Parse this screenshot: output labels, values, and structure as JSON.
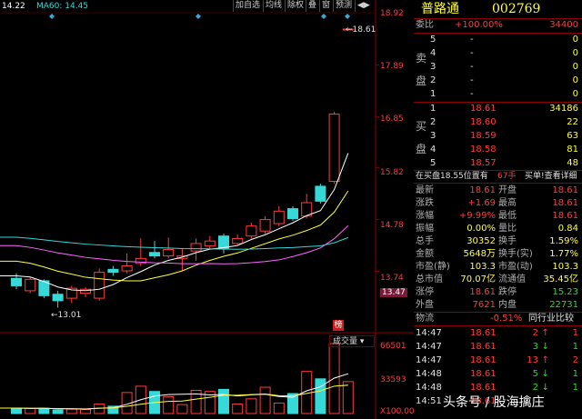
{
  "header": {
    "ma_labels": [
      {
        "text": "14.22",
        "color": "#ffffff"
      },
      {
        "text": "MA60: 14.45",
        "color": "#36d8d8"
      }
    ],
    "toolbar": [
      "加自选",
      "均线",
      "除权",
      "叠",
      "窗",
      "预测",
      "◀▶"
    ]
  },
  "price_axis": [
    "18.92",
    "17.89",
    "16.85",
    "15.82",
    "14.78",
    "13.74",
    "13.47"
  ],
  "price_callouts": {
    "high": "18.61",
    "low": "13.01"
  },
  "volume_axis": [
    "66501",
    "33593",
    "X100.00"
  ],
  "volume_tag": "成交量",
  "bang_badge": "榜",
  "stock": {
    "name": "普路通",
    "code": "002769"
  },
  "ratio": {
    "label": "委比",
    "percent": "+100.00%",
    "value": "34400"
  },
  "sell_side": {
    "label": [
      "卖",
      "盘"
    ],
    "rows": [
      {
        "level": "5",
        "price": "-",
        "volume": "0"
      },
      {
        "level": "4",
        "price": "-",
        "volume": "0"
      },
      {
        "level": "3",
        "price": "-",
        "volume": "0"
      },
      {
        "level": "2",
        "price": "-",
        "volume": "0"
      },
      {
        "level": "1",
        "price": "-",
        "volume": "0"
      }
    ]
  },
  "buy_side": {
    "label": [
      "买",
      "盘"
    ],
    "rows": [
      {
        "level": "1",
        "price": "18.61",
        "volume": "34186"
      },
      {
        "level": "2",
        "price": "18.60",
        "volume": "22"
      },
      {
        "level": "3",
        "price": "18.59",
        "volume": "63"
      },
      {
        "level": "4",
        "price": "18.58",
        "volume": "81"
      },
      {
        "level": "5",
        "price": "18.57",
        "volume": "48"
      }
    ]
  },
  "notice": {
    "left": "在买盘18.55位置有",
    "mid": "67手",
    "right": "买单!查看详细"
  },
  "stats": [
    {
      "l1": "最新",
      "v1": "18.61",
      "l2": "开盘",
      "v2": "18.61",
      "c1": "red",
      "c2": "red"
    },
    {
      "l1": "涨跌",
      "v1": "+1.69",
      "l2": "最高",
      "v2": "18.61",
      "c1": "red",
      "c2": "red"
    },
    {
      "l1": "涨幅",
      "v1": "+9.99%",
      "l2": "最低",
      "v2": "18.61",
      "c1": "red",
      "c2": "red"
    },
    {
      "l1": "振幅",
      "v1": "0.00%",
      "l2": "量比",
      "v2": "0.84",
      "c1": "yellow",
      "c2": "yellow"
    },
    {
      "l1": "总手",
      "v1": "30352",
      "l2": "换手",
      "v2": "1.59%",
      "c1": "yellow",
      "c2": "yellow"
    },
    {
      "l1": "金额",
      "v1": "5648万",
      "l2": "换手(实)",
      "v2": "1.77%",
      "c1": "yellow",
      "c2": "yellow"
    },
    {
      "l1": "市盈(静)",
      "v1": "103.3",
      "l2": "市盈(动)",
      "v2": "103.3",
      "c1": "yellow",
      "c2": "yellow"
    },
    {
      "l1": "总市值",
      "v1": "70.07亿",
      "l2": "流通值",
      "v2": "35.45亿",
      "c1": "yellow",
      "c2": "yellow"
    },
    {
      "l1": "涨停",
      "v1": "18.61",
      "l2": "跌停",
      "v2": "15.23",
      "c1": "red",
      "c2": "green"
    },
    {
      "l1": "外盘",
      "v1": "7621",
      "l2": "内盘",
      "v2": "22731",
      "c1": "red",
      "c2": "green"
    }
  ],
  "tabs": {
    "left": "物流",
    "mid": "-0.51%",
    "right": "同行业比较"
  },
  "ticks": [
    {
      "time": "14:47",
      "price": "18.61",
      "volume": "2",
      "dir": "up",
      "extra": "1"
    },
    {
      "time": "14:47",
      "price": "18.61",
      "volume": "3",
      "dir": "down",
      "extra": "1"
    },
    {
      "time": "14:47",
      "price": "18.61",
      "volume": "13",
      "dir": "up",
      "extra": "2"
    },
    {
      "time": "14:48",
      "price": "18.61",
      "volume": "5",
      "dir": "down",
      "extra": "1"
    },
    {
      "time": "14:48",
      "price": "18.61",
      "volume": "2",
      "dir": "down",
      "extra": "1"
    },
    {
      "time": "14:51",
      "price": "18.61",
      "volume": "",
      "dir": "",
      "extra": ""
    }
  ],
  "watermark": "头条号 / 股海擒庄",
  "colors": {
    "up": "#ff3c3c",
    "down": "#36d8d8",
    "grid": "#8b0000",
    "ma5": "#ffffff",
    "ma10": "#ffff3c",
    "ma20": "#ff66ff",
    "ma60": "#36d8d8"
  },
  "chart_data": {
    "type": "candlestick",
    "ylim": [
      12.8,
      18.92
    ],
    "candles": [
      {
        "o": 13.6,
        "c": 13.45,
        "h": 13.7,
        "l": 13.38
      },
      {
        "o": 13.35,
        "c": 13.58,
        "h": 13.62,
        "l": 13.3
      },
      {
        "o": 13.55,
        "c": 13.25,
        "h": 13.58,
        "l": 13.2
      },
      {
        "o": 13.28,
        "c": 13.15,
        "h": 13.35,
        "l": 13.01
      },
      {
        "o": 13.2,
        "c": 13.4,
        "h": 13.45,
        "l": 13.1
      },
      {
        "o": 13.3,
        "c": 13.38,
        "h": 13.42,
        "l": 13.22
      },
      {
        "o": 13.2,
        "c": 13.72,
        "h": 13.8,
        "l": 13.15
      },
      {
        "o": 13.78,
        "c": 13.72,
        "h": 13.85,
        "l": 13.65
      },
      {
        "o": 13.75,
        "c": 13.85,
        "h": 14.1,
        "l": 13.7
      },
      {
        "o": 13.9,
        "c": 14.0,
        "h": 14.4,
        "l": 13.85
      },
      {
        "o": 14.12,
        "c": 14.05,
        "h": 14.35,
        "l": 14.0
      },
      {
        "o": 14.05,
        "c": 14.18,
        "h": 14.42,
        "l": 14.0
      },
      {
        "o": 14.0,
        "c": 14.05,
        "h": 14.2,
        "l": 13.75
      },
      {
        "o": 14.15,
        "c": 14.3,
        "h": 14.4,
        "l": 13.95
      },
      {
        "o": 14.25,
        "c": 14.35,
        "h": 14.45,
        "l": 14.2
      },
      {
        "o": 14.45,
        "c": 14.2,
        "h": 14.5,
        "l": 14.1
      },
      {
        "o": 14.3,
        "c": 14.4,
        "h": 14.48,
        "l": 14.28
      },
      {
        "o": 14.45,
        "c": 14.65,
        "h": 14.72,
        "l": 14.4
      },
      {
        "o": 14.55,
        "c": 14.78,
        "h": 14.85,
        "l": 14.5
      },
      {
        "o": 14.7,
        "c": 14.95,
        "h": 15.05,
        "l": 14.65
      },
      {
        "o": 15.0,
        "c": 14.8,
        "h": 15.05,
        "l": 14.75
      },
      {
        "o": 14.85,
        "c": 15.12,
        "h": 15.3,
        "l": 14.8
      },
      {
        "o": 15.45,
        "c": 15.15,
        "h": 15.5,
        "l": 15.1
      },
      {
        "o": 15.55,
        "c": 16.9,
        "h": 16.95,
        "l": 15.5
      },
      {
        "o": 18.61,
        "c": 18.61,
        "h": 18.61,
        "l": 18.61
      }
    ],
    "volumes": [
      5200,
      4800,
      5000,
      3500,
      4200,
      3800,
      9000,
      7000,
      20000,
      26000,
      21000,
      16000,
      8500,
      22000,
      21000,
      23000,
      9000,
      14000,
      25000,
      10000,
      19000,
      40000,
      33000,
      66501,
      30352
    ]
  }
}
